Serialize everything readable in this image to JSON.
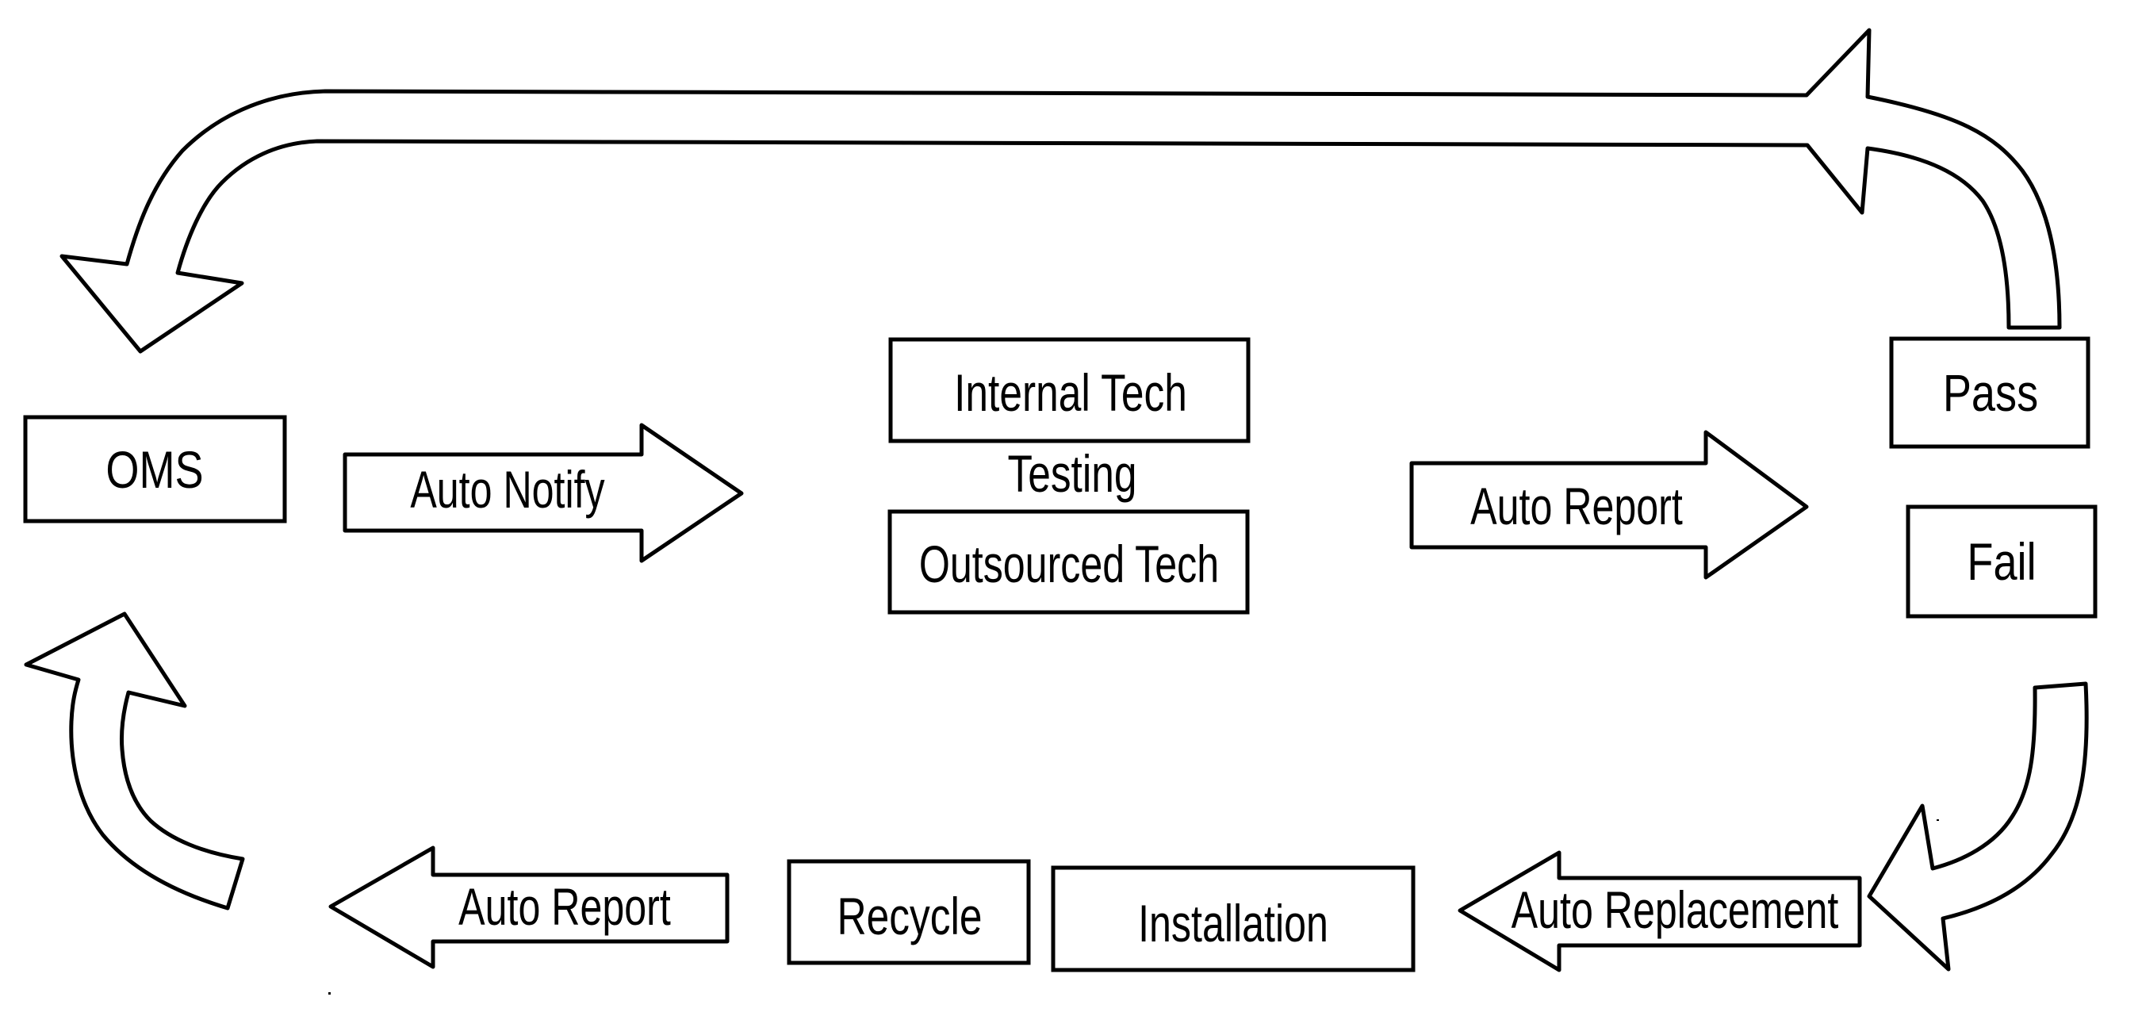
{
  "diagram": {
    "nodes": {
      "oms": "OMS",
      "internal_tech": "Internal Tech",
      "testing": "Testing",
      "outsourced_tech": "Outsourced Tech",
      "pass": "Pass",
      "fail": "Fail",
      "installation": "Installation",
      "recycle": "Recycle"
    },
    "arrows": {
      "auto_notify": "Auto Notify",
      "auto_report_top": "Auto Report",
      "auto_replacement": "Auto Replacement",
      "auto_report_bottom": "Auto Report"
    },
    "colors": {
      "stroke": "#000000",
      "background": "#ffffff"
    }
  }
}
